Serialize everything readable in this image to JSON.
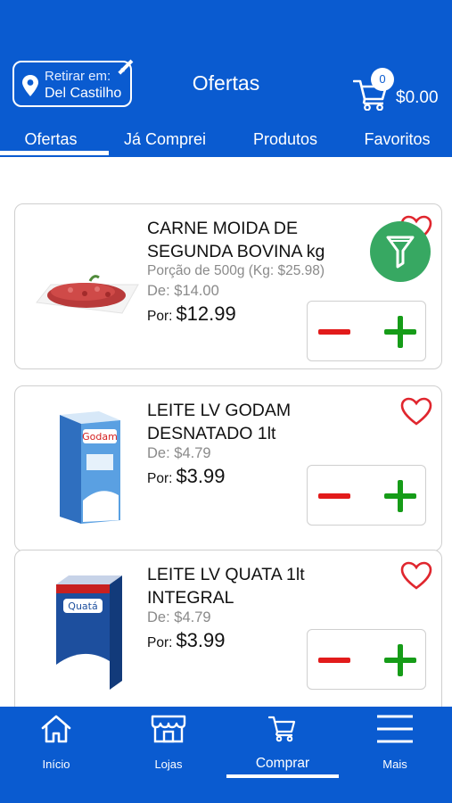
{
  "header": {
    "pickup_label": "Retirar em:",
    "pickup_store": "Del Castilho",
    "title": "Ofertas",
    "cart_count": "0",
    "cart_total": "$0.00"
  },
  "tabs": [
    {
      "label": "Ofertas",
      "active": true
    },
    {
      "label": "Já Comprei",
      "active": false
    },
    {
      "label": "Produtos",
      "active": false
    },
    {
      "label": "Favoritos",
      "active": false
    }
  ],
  "products": [
    {
      "name": "CARNE MOIDA DE SEGUNDA BOVINA kg",
      "portion": "Porção de 500g (Kg: $25.98)",
      "de_label": "De:",
      "de_price": "$14.00",
      "por_label": "Por:",
      "por_price": "$12.99"
    },
    {
      "name": "LEITE LV GODAM DESNATADO 1lt",
      "de_label": "De:",
      "de_price": "$4.79",
      "por_label": "Por:",
      "por_price": "$3.99"
    },
    {
      "name": "LEITE LV QUATA 1lt INTEGRAL",
      "de_label": "De:",
      "de_price": "$4.79",
      "por_label": "Por:",
      "por_price": "$3.99"
    }
  ],
  "bottom_nav": [
    {
      "label": "Início",
      "icon": "home-icon"
    },
    {
      "label": "Lojas",
      "icon": "store-icon"
    },
    {
      "label": "Comprar",
      "icon": "cart-icon",
      "active": true
    },
    {
      "label": "Mais",
      "icon": "menu-icon"
    }
  ],
  "colors": {
    "brand_blue": "#0a5bd0",
    "minus_red": "#e21b1b",
    "plus_green": "#169c18",
    "filter_green": "#37a862",
    "heart_red": "#e0262e"
  }
}
